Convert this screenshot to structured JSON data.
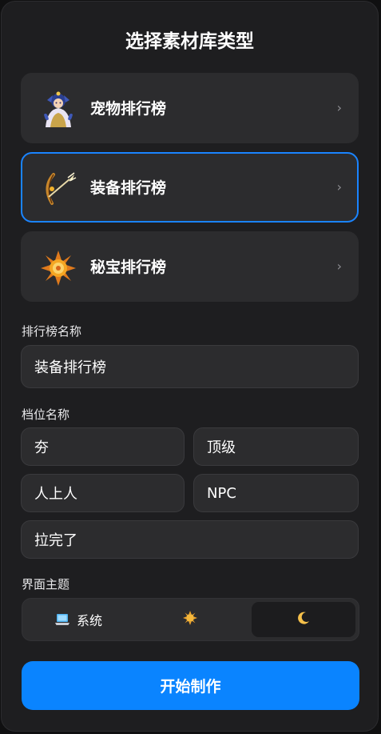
{
  "header": {
    "title": "选择素材库类型"
  },
  "library_types": [
    {
      "label": "宠物排行榜",
      "icon": "pet-character-icon",
      "chevron": "›",
      "selected": false
    },
    {
      "label": "装备排行榜",
      "icon": "bow-weapon-icon",
      "chevron": "›",
      "selected": true
    },
    {
      "label": "秘宝排行榜",
      "icon": "sun-treasure-icon",
      "chevron": "›",
      "selected": false
    }
  ],
  "ranking_name": {
    "label": "排行榜名称",
    "value": "装备排行榜"
  },
  "tiers": {
    "label": "档位名称",
    "values": [
      "夯",
      "顶级",
      "人上人",
      "NPC",
      "拉完了"
    ]
  },
  "theme": {
    "label": "界面主题",
    "options": [
      {
        "label": "系统",
        "icon": "laptop-icon",
        "active": false
      },
      {
        "label": "",
        "icon": "sun-icon",
        "active": false
      },
      {
        "label": "",
        "icon": "moon-icon",
        "active": true
      }
    ]
  },
  "start_button": {
    "label": "开始制作"
  },
  "colors": {
    "accent": "#0a84ff",
    "panel": "#1e1e20",
    "card": "#2c2c2e"
  }
}
